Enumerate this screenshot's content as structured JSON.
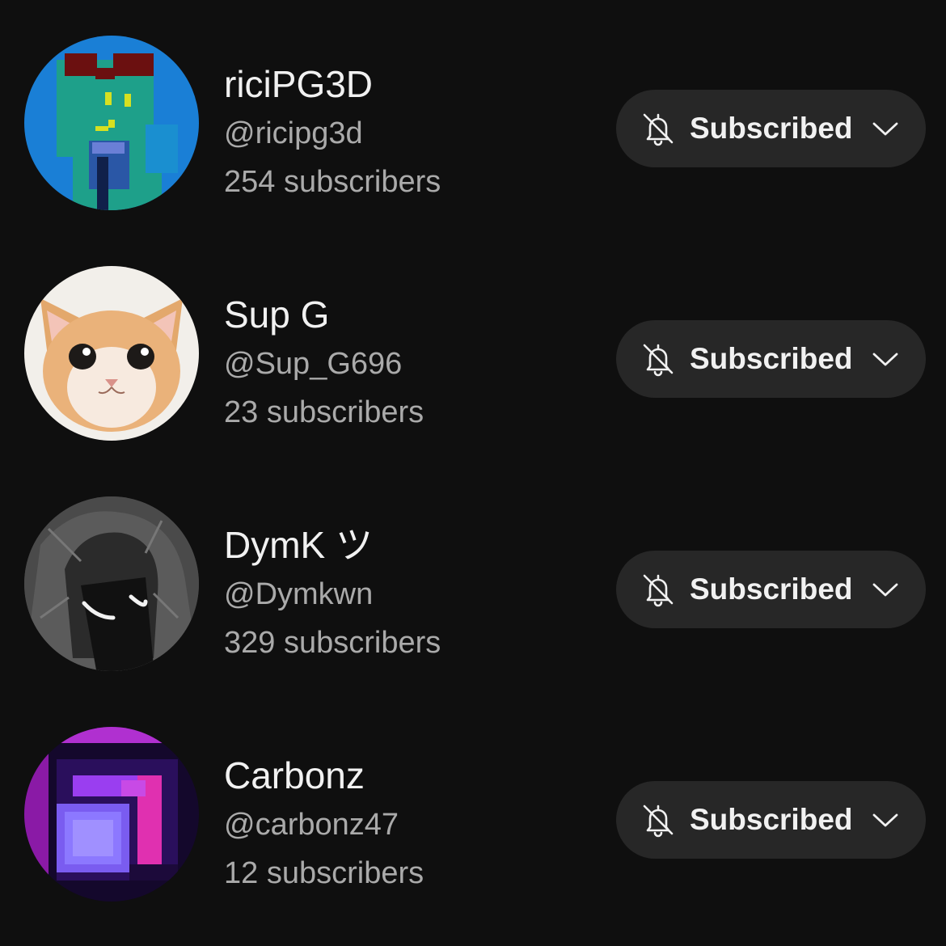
{
  "subscribe_label": "Subscribed",
  "icons": {
    "bell": "bell-off-icon",
    "chevron": "chevron-down-icon"
  },
  "colors": {
    "background": "#0f0f0f",
    "button_bg": "#272727",
    "primary_text": "#f1f1f1",
    "secondary_text": "#aaaaaa"
  },
  "channels": [
    {
      "name": "riciPG3D",
      "handle": "@ricipg3d",
      "subscribers": "254 subscribers",
      "button_label": "Subscribed"
    },
    {
      "name": "Sup G",
      "handle": "@Sup_G696",
      "subscribers": "23 subscribers",
      "button_label": "Subscribed"
    },
    {
      "name": "DymK ツ",
      "handle": "@Dymkwn",
      "subscribers": "329 subscribers",
      "button_label": "Subscribed"
    },
    {
      "name": "Carbonz",
      "handle": "@carbonz47",
      "subscribers": "12 subscribers",
      "button_label": "Subscribed"
    }
  ]
}
